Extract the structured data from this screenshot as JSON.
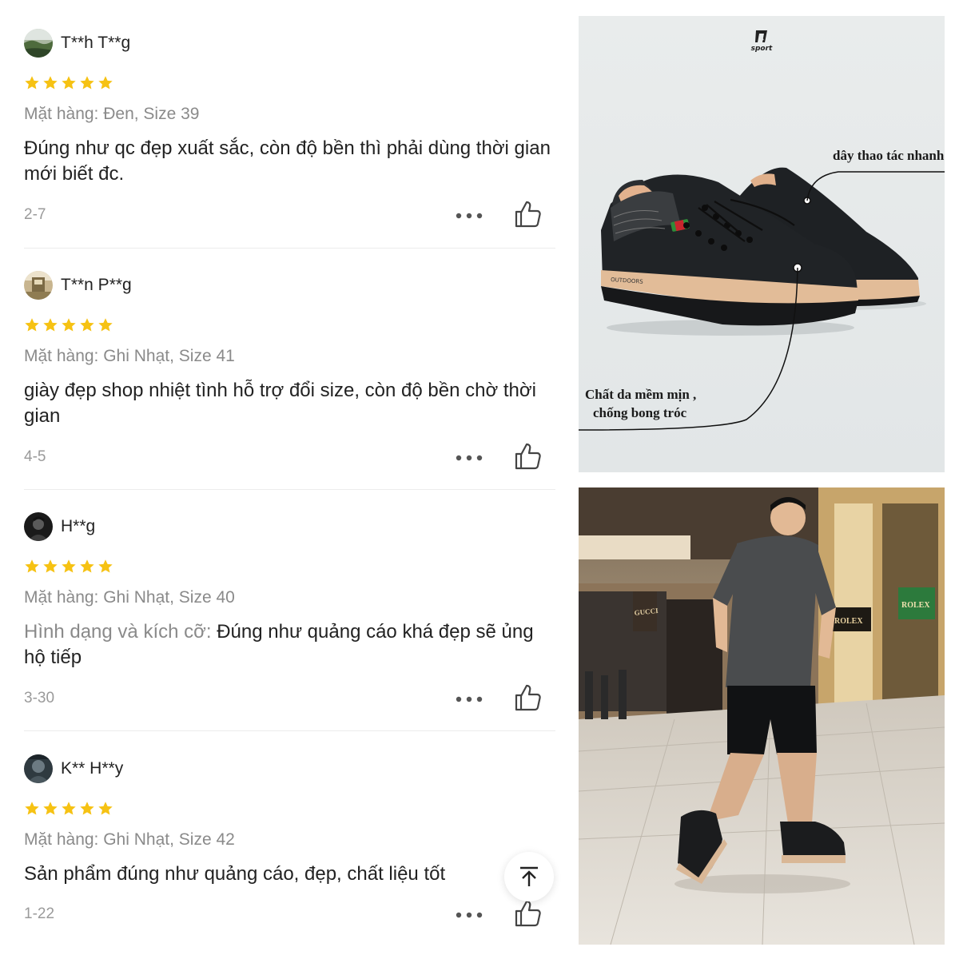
{
  "reviews": [
    {
      "username": "T**h T**g",
      "rating": 5,
      "variant": "Mặt hàng: Đen, Size 39",
      "comment_prefix": "",
      "comment": "Đúng như qc đẹp xuất sắc, còn độ bền thì phải dùng thời gian mới biết đc.",
      "date": "2-7"
    },
    {
      "username": "T**n P**g",
      "rating": 5,
      "variant": "Mặt hàng: Ghi Nhạt, Size 41",
      "comment_prefix": "",
      "comment": "giày đẹp shop nhiệt tình hỗ trợ đổi size, còn độ bền chờ thời gian",
      "date": "4-5"
    },
    {
      "username": "H**g",
      "rating": 5,
      "variant": "Mặt hàng: Ghi Nhạt, Size 40",
      "comment_prefix": "Hình dạng và kích cỡ: ",
      "comment": "Đúng như quảng cáo khá đẹp sẽ ủng hộ tiếp",
      "date": "3-30"
    },
    {
      "username": "K** H**y",
      "rating": 5,
      "variant": "Mặt hàng: Ghi Nhạt, Size 42",
      "comment_prefix": "",
      "comment": "Sản phẩm đúng như quảng cáo, đẹp, chất liệu tốt",
      "date": "1-22"
    }
  ],
  "product_image": {
    "brand_logo_text": "sport",
    "annotation_laces": "dây thao tác nhanh",
    "annotation_leather_line1": "Chất da  mềm mịn ,",
    "annotation_leather_line2": "chống bong tróc"
  },
  "lifestyle_image": {
    "store_signs": [
      "GUCCI",
      "ROLEX",
      "ROLEX"
    ]
  },
  "colors": {
    "star": "#F6C213",
    "text_muted": "#8a8a8a",
    "divider": "#ececec"
  },
  "icons": [
    "more-options-icon",
    "thumbs-up-icon",
    "scroll-to-top-icon",
    "star-icon"
  ]
}
